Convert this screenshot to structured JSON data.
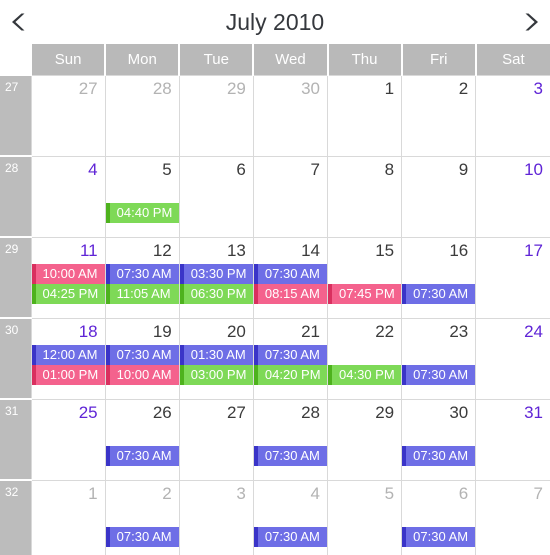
{
  "header": {
    "title": "July 2010",
    "prev_label": "‹",
    "next_label": "›",
    "prev_icon": "chevron-left-icon",
    "next_icon": "chevron-right-icon"
  },
  "weekdays": [
    "Sun",
    "Mon",
    "Tue",
    "Wed",
    "Thu",
    "Fri",
    "Sat"
  ],
  "colors": {
    "header_bg": "#b9b9b9",
    "weeknum_bg": "#bcbcbc",
    "grid_line": "#d9d9d9",
    "weekend_text": "#5f24d6",
    "other_month_text": "#b3b3b3",
    "day_text": "#3b3b3b",
    "event_pink": "#f4628d",
    "event_green": "#7ed957",
    "event_blue": "#6e6ee6",
    "arrow": "#35383d"
  },
  "weeks": [
    {
      "number": "27",
      "days": [
        {
          "num": "27",
          "other": true,
          "weekend": true,
          "events": []
        },
        {
          "num": "28",
          "other": true,
          "weekend": false,
          "events": []
        },
        {
          "num": "29",
          "other": true,
          "weekend": false,
          "events": []
        },
        {
          "num": "30",
          "other": true,
          "weekend": false,
          "events": []
        },
        {
          "num": "1",
          "other": false,
          "weekend": false,
          "events": []
        },
        {
          "num": "2",
          "other": false,
          "weekend": false,
          "events": []
        },
        {
          "num": "3",
          "other": false,
          "weekend": true,
          "events": []
        }
      ]
    },
    {
      "number": "28",
      "days": [
        {
          "num": "4",
          "other": false,
          "weekend": true,
          "events": []
        },
        {
          "num": "5",
          "other": false,
          "weekend": false,
          "events": [
            {
              "slot": 1,
              "color": "green",
              "label": "04:40 PM"
            }
          ]
        },
        {
          "num": "6",
          "other": false,
          "weekend": false,
          "events": []
        },
        {
          "num": "7",
          "other": false,
          "weekend": false,
          "events": []
        },
        {
          "num": "8",
          "other": false,
          "weekend": false,
          "events": []
        },
        {
          "num": "9",
          "other": false,
          "weekend": false,
          "events": []
        },
        {
          "num": "10",
          "other": false,
          "weekend": true,
          "events": []
        }
      ]
    },
    {
      "number": "29",
      "days": [
        {
          "num": "11",
          "other": false,
          "weekend": true,
          "events": [
            {
              "slot": 0,
              "color": "pink",
              "label": "10:00 AM"
            },
            {
              "slot": 1,
              "color": "green",
              "label": "04:25 PM"
            }
          ]
        },
        {
          "num": "12",
          "other": false,
          "weekend": false,
          "events": [
            {
              "slot": 0,
              "color": "blue",
              "label": "07:30 AM"
            },
            {
              "slot": 1,
              "color": "green",
              "label": "11:05 AM"
            }
          ]
        },
        {
          "num": "13",
          "other": false,
          "weekend": false,
          "events": [
            {
              "slot": 0,
              "color": "blue",
              "label": "03:30 PM"
            },
            {
              "slot": 1,
              "color": "green",
              "label": "06:30 PM"
            }
          ]
        },
        {
          "num": "14",
          "other": false,
          "weekend": false,
          "events": [
            {
              "slot": 0,
              "color": "blue",
              "label": "07:30 AM"
            },
            {
              "slot": 1,
              "color": "pink",
              "label": "08:15 AM"
            }
          ]
        },
        {
          "num": "15",
          "other": false,
          "weekend": false,
          "events": [
            {
              "slot": 1,
              "color": "pink",
              "label": "07:45 PM"
            }
          ]
        },
        {
          "num": "16",
          "other": false,
          "weekend": false,
          "events": [
            {
              "slot": 1,
              "color": "blue",
              "label": "07:30 AM"
            }
          ]
        },
        {
          "num": "17",
          "other": false,
          "weekend": true,
          "events": []
        }
      ]
    },
    {
      "number": "30",
      "days": [
        {
          "num": "18",
          "other": false,
          "weekend": true,
          "events": [
            {
              "slot": 0,
              "color": "blue",
              "label": "12:00 AM"
            },
            {
              "slot": 1,
              "color": "pink",
              "label": "01:00 PM"
            }
          ]
        },
        {
          "num": "19",
          "other": false,
          "weekend": false,
          "events": [
            {
              "slot": 0,
              "color": "blue",
              "label": "07:30 AM"
            },
            {
              "slot": 1,
              "color": "pink",
              "label": "10:00 AM"
            }
          ]
        },
        {
          "num": "20",
          "other": false,
          "weekend": false,
          "events": [
            {
              "slot": 0,
              "color": "blue",
              "label": "01:30 AM"
            },
            {
              "slot": 1,
              "color": "green",
              "label": "03:00 PM"
            }
          ]
        },
        {
          "num": "21",
          "other": false,
          "weekend": false,
          "events": [
            {
              "slot": 0,
              "color": "blue",
              "label": "07:30 AM"
            },
            {
              "slot": 1,
              "color": "green",
              "label": "04:20 PM"
            }
          ]
        },
        {
          "num": "22",
          "other": false,
          "weekend": false,
          "events": [
            {
              "slot": 1,
              "color": "green",
              "label": "04:30 PM"
            }
          ]
        },
        {
          "num": "23",
          "other": false,
          "weekend": false,
          "events": [
            {
              "slot": 1,
              "color": "blue",
              "label": "07:30 AM"
            }
          ]
        },
        {
          "num": "24",
          "other": false,
          "weekend": true,
          "events": []
        }
      ]
    },
    {
      "number": "31",
      "days": [
        {
          "num": "25",
          "other": false,
          "weekend": true,
          "events": []
        },
        {
          "num": "26",
          "other": false,
          "weekend": false,
          "events": [
            {
              "slot": 1,
              "color": "blue",
              "label": "07:30 AM"
            }
          ]
        },
        {
          "num": "27",
          "other": false,
          "weekend": false,
          "events": []
        },
        {
          "num": "28",
          "other": false,
          "weekend": false,
          "events": [
            {
              "slot": 1,
              "color": "blue",
              "label": "07:30 AM"
            }
          ]
        },
        {
          "num": "29",
          "other": false,
          "weekend": false,
          "events": []
        },
        {
          "num": "30",
          "other": false,
          "weekend": false,
          "events": [
            {
              "slot": 1,
              "color": "blue",
              "label": "07:30 AM"
            }
          ]
        },
        {
          "num": "31",
          "other": false,
          "weekend": true,
          "events": []
        }
      ]
    },
    {
      "number": "32",
      "days": [
        {
          "num": "1",
          "other": true,
          "weekend": true,
          "events": []
        },
        {
          "num": "2",
          "other": true,
          "weekend": false,
          "events": [
            {
              "slot": 1,
              "color": "blue",
              "label": "07:30 AM"
            }
          ]
        },
        {
          "num": "3",
          "other": true,
          "weekend": false,
          "events": []
        },
        {
          "num": "4",
          "other": true,
          "weekend": false,
          "events": [
            {
              "slot": 1,
              "color": "blue",
              "label": "07:30 AM"
            }
          ]
        },
        {
          "num": "5",
          "other": true,
          "weekend": false,
          "events": []
        },
        {
          "num": "6",
          "other": true,
          "weekend": false,
          "events": [
            {
              "slot": 1,
              "color": "blue",
              "label": "07:30 AM"
            }
          ]
        },
        {
          "num": "7",
          "other": true,
          "weekend": true,
          "events": []
        }
      ]
    }
  ]
}
